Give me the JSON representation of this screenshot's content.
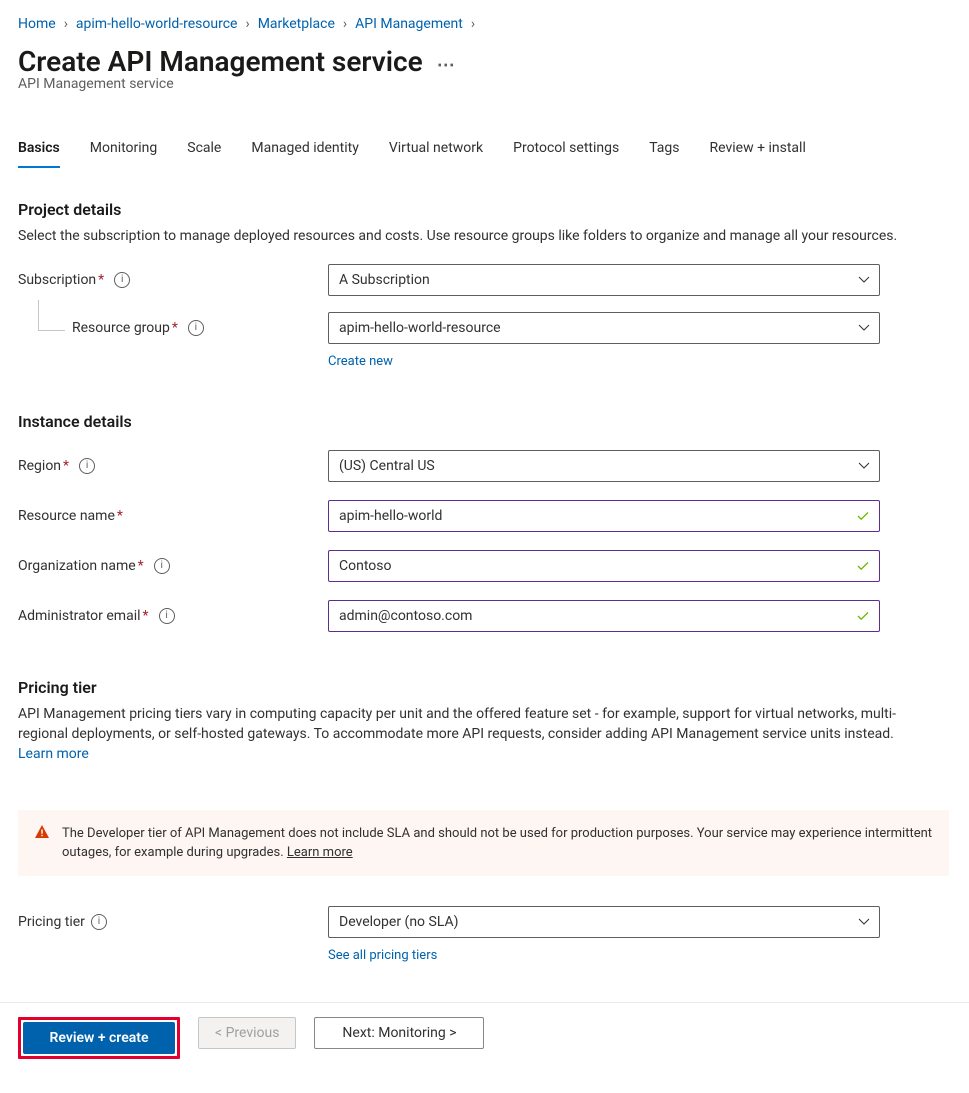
{
  "breadcrumb": {
    "items": [
      "Home",
      "apim-hello-world-resource",
      "Marketplace",
      "API Management"
    ]
  },
  "page": {
    "title": "Create API Management service",
    "subtitle": "API Management service"
  },
  "tabs": {
    "items": [
      "Basics",
      "Monitoring",
      "Scale",
      "Managed identity",
      "Virtual network",
      "Protocol settings",
      "Tags",
      "Review + install"
    ],
    "active_index": 0
  },
  "project_details": {
    "heading": "Project details",
    "description": "Select the subscription to manage deployed resources and costs. Use resource groups like folders to organize and manage all your resources.",
    "subscription": {
      "label": "Subscription",
      "value": "A Subscription"
    },
    "resource_group": {
      "label": "Resource group",
      "value": "apim-hello-world-resource",
      "create_new": "Create new"
    }
  },
  "instance_details": {
    "heading": "Instance details",
    "region": {
      "label": "Region",
      "value": "(US) Central US"
    },
    "resource_name": {
      "label": "Resource name",
      "value": "apim-hello-world"
    },
    "organization_name": {
      "label": "Organization name",
      "value": "Contoso"
    },
    "admin_email": {
      "label": "Administrator email",
      "value": "admin@contoso.com"
    }
  },
  "pricing_tier": {
    "heading": "Pricing tier",
    "description": "API Management pricing tiers vary in computing capacity per unit and the offered feature set - for example, support for virtual networks, multi-regional deployments, or self-hosted gateways. To accommodate more API requests, consider adding API Management service units instead.",
    "learn_more": "Learn more",
    "warning": "The Developer tier of API Management does not include SLA and should not be used for production purposes. Your service may experience intermittent outages, for example during upgrades.",
    "warning_learn_more": "Learn more",
    "field_label": "Pricing tier",
    "value": "Developer (no SLA)",
    "see_all": "See all pricing tiers"
  },
  "footer": {
    "review_create": "Review + create",
    "previous": "< Previous",
    "next": "Next: Monitoring >"
  }
}
